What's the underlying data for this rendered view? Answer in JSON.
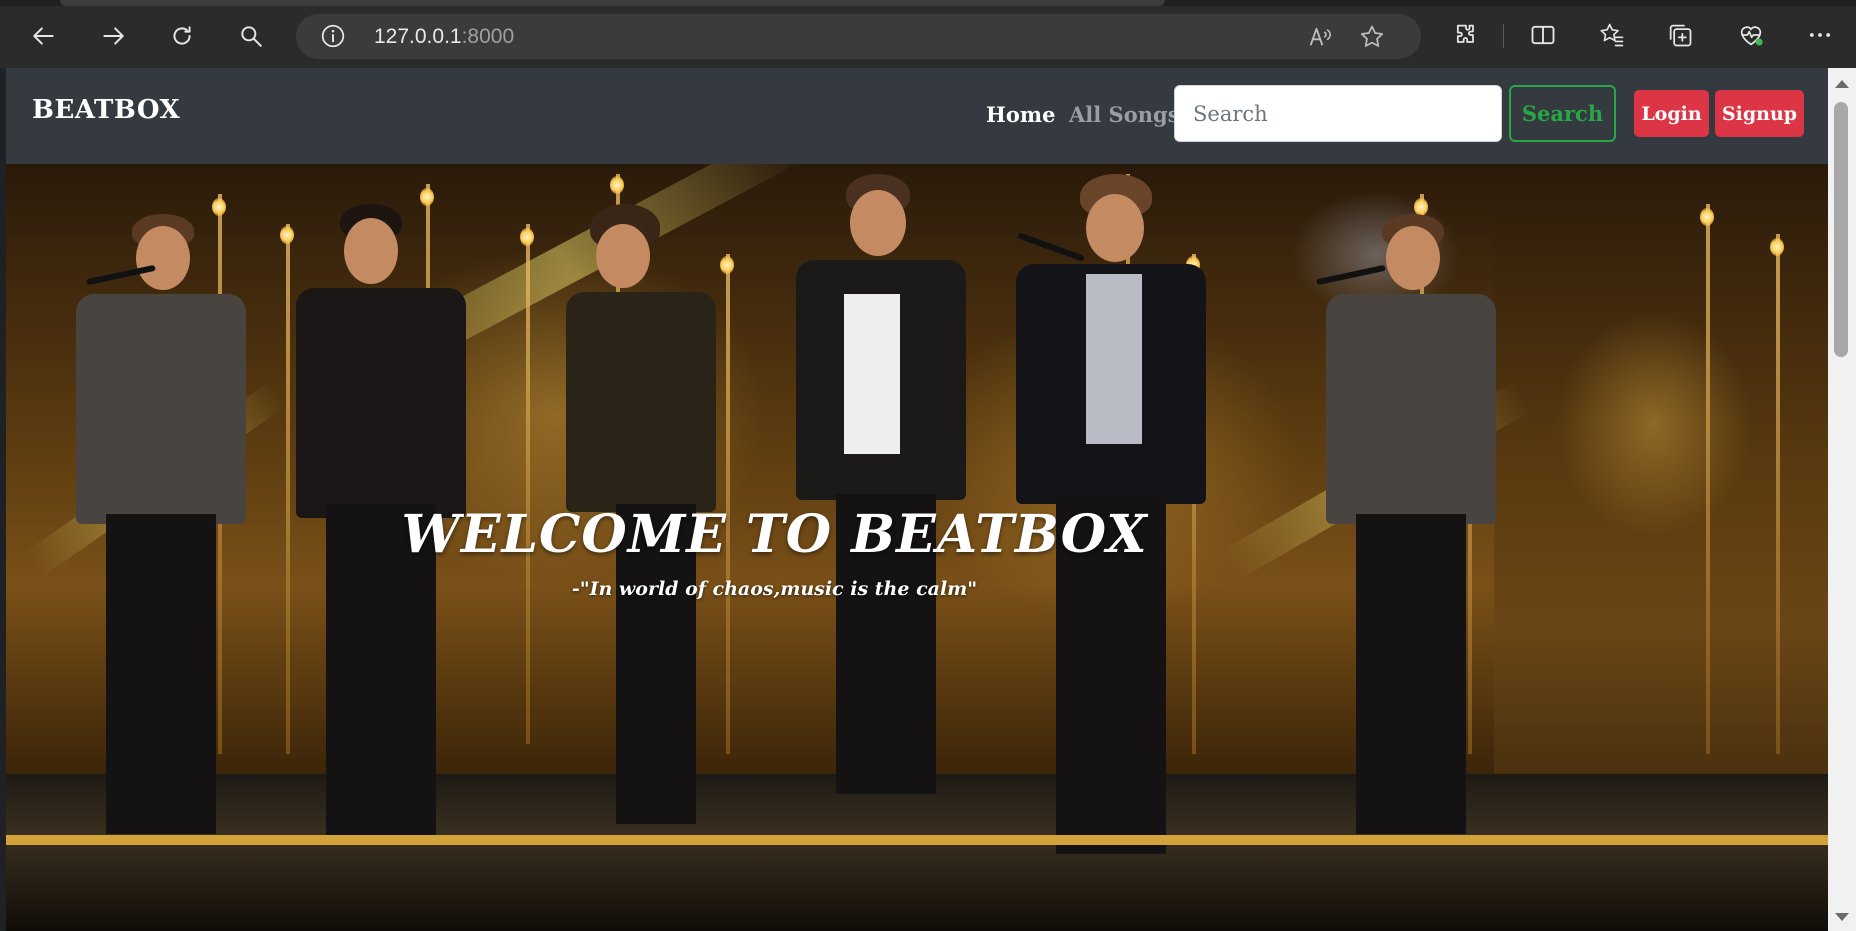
{
  "browser": {
    "url_host": "127.0.0.1",
    "url_port": ":8000"
  },
  "site": {
    "brand": "BEATBOX",
    "nav": {
      "home": "Home",
      "all_songs": "All Songs"
    },
    "search": {
      "placeholder": "Search",
      "button": "Search"
    },
    "auth": {
      "login": "Login",
      "signup": "Signup"
    },
    "hero": {
      "title": "WELCOME TO BEATBOX",
      "quote": "-\"In world of chaos,music is the calm\""
    }
  },
  "colors": {
    "navbar": "#343a40",
    "success": "#28a745",
    "danger": "#dc3545"
  }
}
